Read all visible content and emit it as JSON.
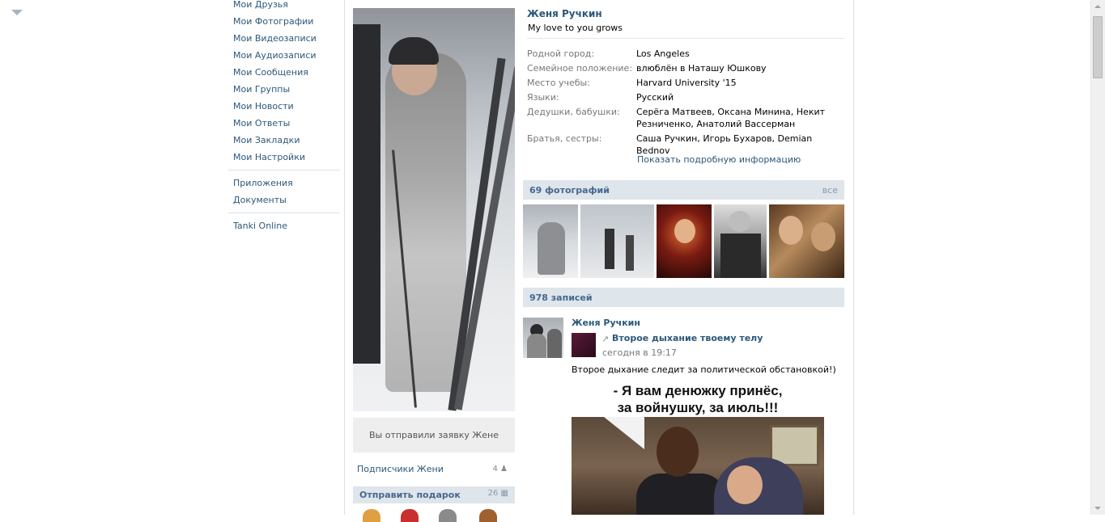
{
  "left_menu": {
    "items": [
      "Мои Друзья",
      "Мои Фотографии",
      "Мои Видеозаписи",
      "Мои Аудиозаписи",
      "Мои Сообщения",
      "Мои Группы",
      "Мои Новости",
      "Мои Ответы",
      "Мои Закладки",
      "Мои Настройки"
    ],
    "apps": [
      "Приложения",
      "Документы"
    ],
    "games": [
      "Tanki Online"
    ]
  },
  "profile": {
    "request_text": "Вы отправили заявку Жене",
    "followers_label": "Подписчики Жени",
    "followers_count": "4",
    "gift_label": "Отправить подарок",
    "gift_count": "26"
  },
  "info": {
    "name": "Женя Ручкин",
    "status": "My love to you grows",
    "rows": [
      {
        "label": "Родной город:",
        "value": "Los Angeles"
      },
      {
        "label": "Семейное положение:",
        "value": "влюблён в Наташу Юшкову"
      },
      {
        "label": "Место учебы:",
        "value": "Harvard University '15"
      },
      {
        "label": "Языки:",
        "value": "Русский"
      },
      {
        "label": "Дедушки, бабушки:",
        "value": "Серёга Матвеев, Оксана Минина, Некит Резниченко, Анатолий Вассерман"
      },
      {
        "label": "Братья, сестры:",
        "value": "Саша Ручкин, Игорь Бухаров, Demian Bednov"
      }
    ],
    "more_link": "Показать подробную информацию"
  },
  "photos": {
    "title": "69 фотографий",
    "all": "все"
  },
  "wall": {
    "title": "978 записей",
    "post": {
      "author": "Женя Ручкин",
      "repost_title": "Второе дыхание твоему телу",
      "time": "сегодня в 19:17",
      "text": "Второе дыхание следит за политической обстановкой!)",
      "meme_line1": "- Я вам денюжку принёс,",
      "meme_line2": "за войнушку, за июль!!!"
    }
  }
}
